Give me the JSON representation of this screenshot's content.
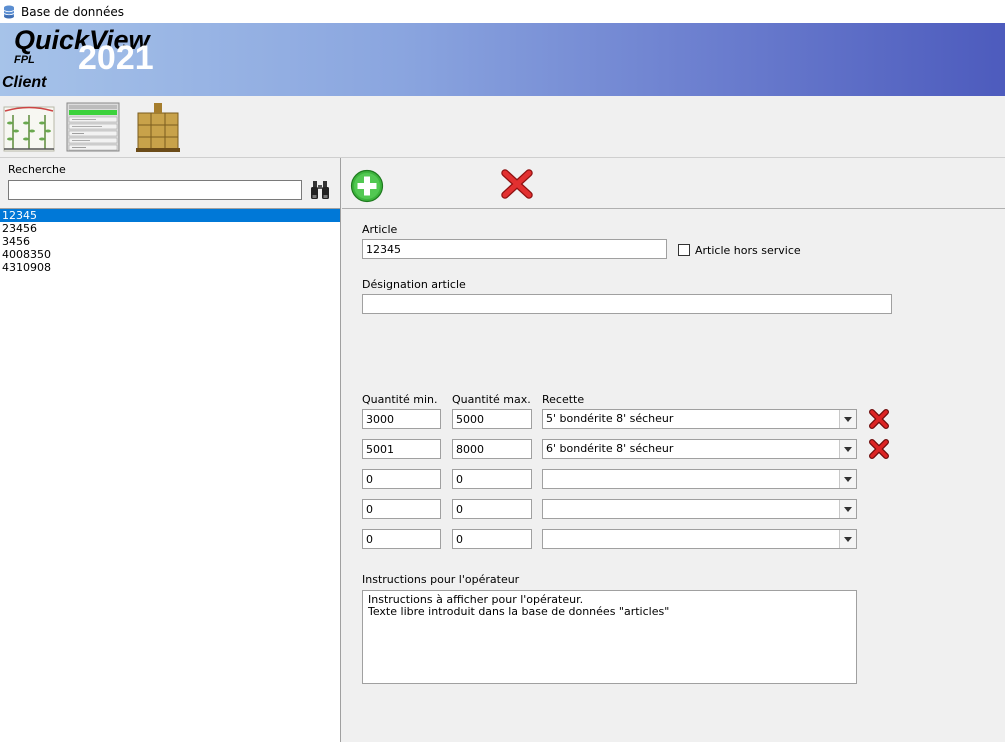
{
  "window": {
    "title": "Base de données"
  },
  "banner": {
    "brand": "QuickView",
    "fpl": "FPL",
    "year": "2021",
    "client": "Client"
  },
  "toolbar": {
    "tools": [
      "plant-icon",
      "process-list-icon",
      "pallet-icon"
    ]
  },
  "left": {
    "search_label": "Recherche",
    "search_value": "",
    "items": [
      "12345",
      "23456",
      "3456",
      "4008350",
      "4310908"
    ],
    "selected_index": 0
  },
  "form": {
    "article_label": "Article",
    "article_value": "12345",
    "hors_service_label": "Article hors service",
    "designation_label": "Désignation article",
    "designation_value": "",
    "qmin_label": "Quantité min.",
    "qmax_label": "Quantité max.",
    "recette_label": "Recette",
    "rows": [
      {
        "min": "3000",
        "max": "5000",
        "recette": "5' bondérite 8' sécheur"
      },
      {
        "min": "5001",
        "max": "8000",
        "recette": "6' bondérite 8' sécheur"
      },
      {
        "min": "0",
        "max": "0",
        "recette": ""
      },
      {
        "min": "0",
        "max": "0",
        "recette": ""
      },
      {
        "min": "0",
        "max": "0",
        "recette": ""
      }
    ],
    "instructions_label": "Instructions pour l'opérateur",
    "instructions_text": "Instructions à afficher pour l'opérateur.\nTexte libre introduit dans la base de données \"articles\""
  },
  "colors": {
    "accent": "#0078d7",
    "banner_start": "#a6c3e9",
    "banner_end": "#4d5bbd",
    "delete_red": "#d81e1e",
    "add_green": "#3cb43c"
  }
}
